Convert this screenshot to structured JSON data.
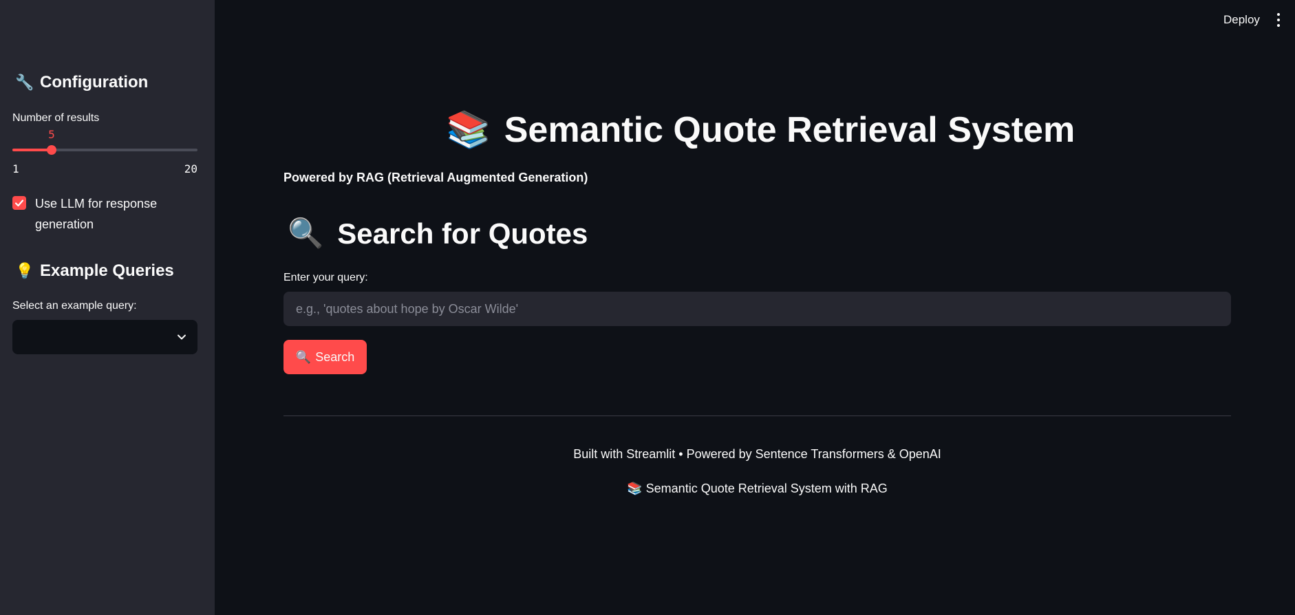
{
  "header": {
    "deploy_label": "Deploy",
    "menu_icon": "kebab-menu-icon"
  },
  "sidebar": {
    "config_icon": "🔧",
    "config_heading": "Configuration",
    "slider": {
      "label": "Number of results",
      "value": 5,
      "min": 1,
      "max": 20,
      "value_text": "5",
      "min_text": "1",
      "max_text": "20"
    },
    "llm_checkbox": {
      "checked": true,
      "label": "Use LLM for response generation"
    },
    "examples_icon": "💡",
    "examples_heading": "Example Queries",
    "select": {
      "label": "Select an example query:",
      "selected": ""
    }
  },
  "main": {
    "title_icon": "📚",
    "title": "Semantic Quote Retrieval System",
    "subtitle": "Powered by RAG (Retrieval Augmented Generation)",
    "search_icon": "🔍",
    "search_heading": "Search for Quotes",
    "query_label": "Enter your query:",
    "query_value": "",
    "query_placeholder": "e.g., 'quotes about hope by Oscar Wilde'",
    "search_button_icon": "🔍",
    "search_button_label": "Search"
  },
  "footer": {
    "line1": "Built with Streamlit • Powered by Sentence Transformers & OpenAI",
    "line2_icon": "📚",
    "line2": "Semantic Quote Retrieval System with RAG"
  },
  "colors": {
    "accent": "#ff4b4b",
    "background": "#0e1117",
    "sidebar": "#262730",
    "text": "#fafafa"
  }
}
